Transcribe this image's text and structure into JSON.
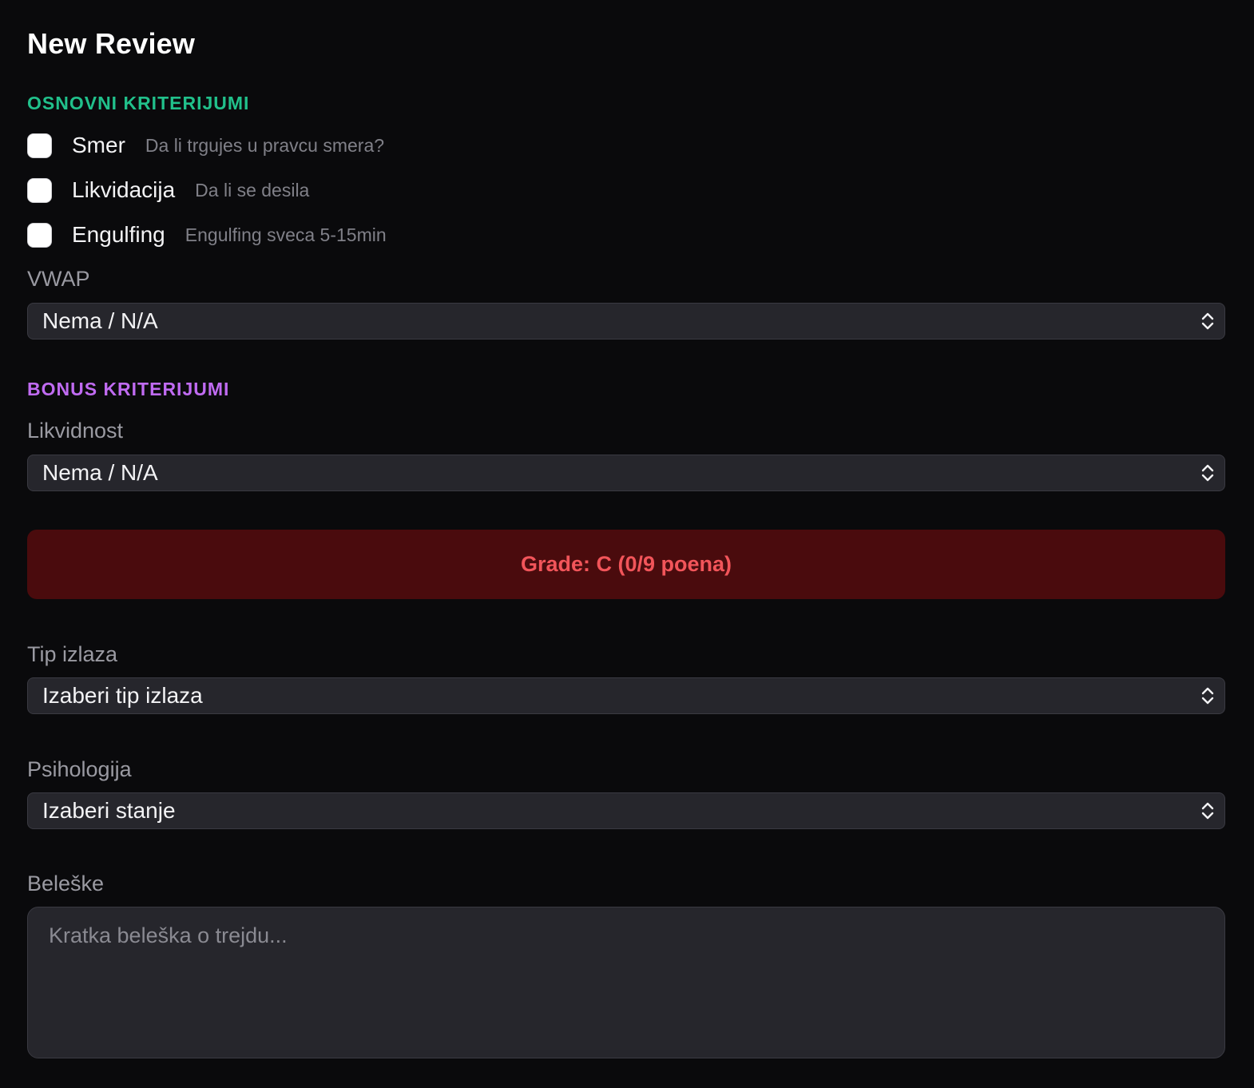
{
  "page": {
    "title": "New Review"
  },
  "basic_criteria": {
    "heading": "OSNOVNI KRITERIJUMI",
    "items": [
      {
        "label": "Smer",
        "hint": "Da li trgujes u pravcu smera?",
        "checked": false
      },
      {
        "label": "Likvidacija",
        "hint": "Da li se desila",
        "checked": false
      },
      {
        "label": "Engulfing",
        "hint": "Engulfing sveca 5-15min",
        "checked": false
      }
    ],
    "vwap": {
      "label": "VWAP",
      "value": "Nema / N/A"
    }
  },
  "bonus_criteria": {
    "heading": "BONUS KRITERIJUMI",
    "likvidnost": {
      "label": "Likvidnost",
      "value": "Nema / N/A"
    }
  },
  "grade": {
    "text": "Grade: C (0/9 poena)"
  },
  "exit_type": {
    "label": "Tip izlaza",
    "value": "Izaberi tip izlaza"
  },
  "psychology": {
    "label": "Psihologija",
    "value": "Izaberi stanje"
  },
  "notes": {
    "label": "Beleške",
    "placeholder": "Kratka beleška o trejdu...",
    "value": ""
  },
  "colors": {
    "background": "#0a0a0c",
    "basic_accent": "#21c08b",
    "bonus_accent": "#c06bf2",
    "grade_bg": "#4a0b0d",
    "grade_text": "#f2555a",
    "field_bg": "#26262c"
  },
  "icons": {
    "select_arrows": "chevron-up-down-icon"
  }
}
